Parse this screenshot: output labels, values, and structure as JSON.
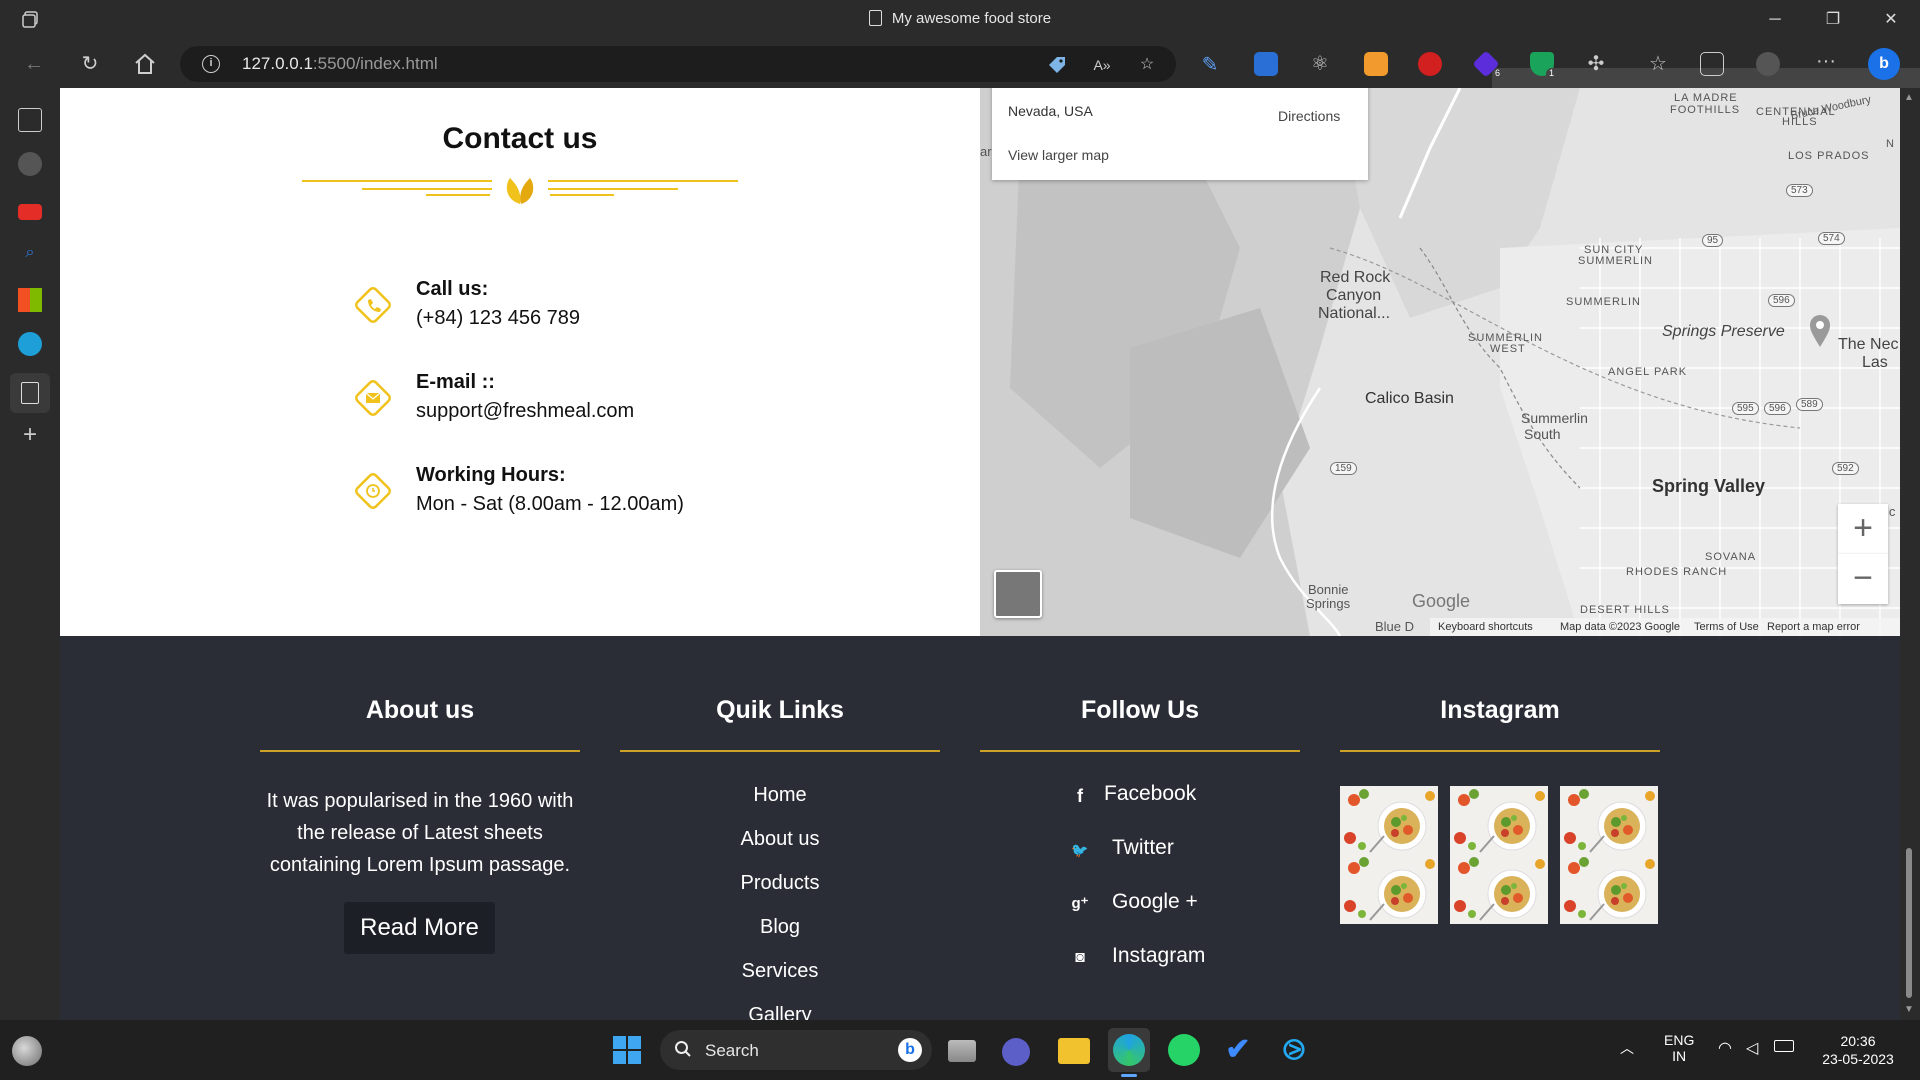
{
  "browser": {
    "tab_title": "My awesome food store",
    "url_host": "127.0.0.1",
    "url_rest": ":5500/index.html",
    "extension_badges": {
      "ext6": "6",
      "ext7": "1"
    }
  },
  "contact": {
    "title": "Contact us",
    "items": [
      {
        "label": "Call us:",
        "value": "(+84) 123 456 789",
        "icon": "phone-icon"
      },
      {
        "label": "E-mail ::",
        "value": "support@freshmeal.com",
        "icon": "mail-icon"
      },
      {
        "label": "Working Hours:",
        "value": "Mon - Sat (8.00am - 12.00am)",
        "icon": "clock-icon"
      }
    ],
    "accent_color": "#f0c21b"
  },
  "map": {
    "card": {
      "location": "Nevada, USA",
      "directions": "Directions",
      "larger_map": "View larger map"
    },
    "labels": {
      "la_madre": "LA MADRE",
      "foothills": "FOOTHILLS",
      "centennial": "CENTENNIAL",
      "hills": "HILLS",
      "bruce": "Bruce Woodbury",
      "los_prados": "LOS PRADOS",
      "sun_city": "SUN CITY",
      "summerlin_sc": "SUMMERLIN",
      "red_rock_1": "Red Rock",
      "red_rock_2": "Canyon",
      "red_rock_3": "National...",
      "summerlin": "SUMMERLIN",
      "summerlin_west_1": "SUMMERLIN",
      "summerlin_west_2": "WEST",
      "springs_preserve": "Springs Preserve",
      "the_nec": "The Nec",
      "las": "Las",
      "angel_park": "ANGEL PARK",
      "calico_basin": "Calico Basin",
      "summerlin_south_1": "Summerlin",
      "summerlin_south_2": "South",
      "spring_valley": "Spring Valley",
      "sovana": "SOVANA",
      "rhodes_ranch": "RHODES RANCH",
      "bonnie_1": "Bonnie",
      "bonnie_2": "Springs",
      "desert_hills": "DESERT HILLS",
      "blue_d": "Blue D",
      "ar": "ar",
      "ic": "ic",
      "n": "N",
      "r573": "573",
      "r574": "574",
      "r95": "95",
      "r596a": "596",
      "r595": "595",
      "r596b": "596",
      "r589": "589",
      "r159": "159",
      "r592": "592"
    },
    "zoom_in": "+",
    "zoom_out": "−",
    "google": "Google",
    "footer": {
      "shortcuts": "Keyboard shortcuts",
      "data": "Map data ©2023 Google",
      "terms": "Terms of Use",
      "report": "Report a map error"
    }
  },
  "footer": {
    "about": {
      "title": "About us",
      "text": "It was popularised in the 1960 with the release of Latest sheets containing Lorem Ipsum passage.",
      "button": "Read More"
    },
    "links": {
      "title": "Quik Links",
      "items": [
        "Home",
        "About us",
        "Products",
        "Blog",
        "Services",
        "Gallery"
      ]
    },
    "follow": {
      "title": "Follow Us",
      "items": [
        {
          "icon": "facebook-icon",
          "glyph": "f",
          "label": "Facebook"
        },
        {
          "icon": "twitter-icon",
          "glyph": "🐦",
          "label": "Twitter"
        },
        {
          "icon": "google-plus-icon",
          "glyph": "g⁺",
          "label": "Google +"
        },
        {
          "icon": "instagram-icon",
          "glyph": "◙",
          "label": "Instagram"
        }
      ]
    },
    "instagram": {
      "title": "Instagram"
    },
    "background": "#2a2c36",
    "rule_color": "#c9a227"
  },
  "taskbar": {
    "search_placeholder": "Search",
    "lang_1": "ENG",
    "lang_2": "IN",
    "time": "20:36",
    "date": "23-05-2023"
  }
}
